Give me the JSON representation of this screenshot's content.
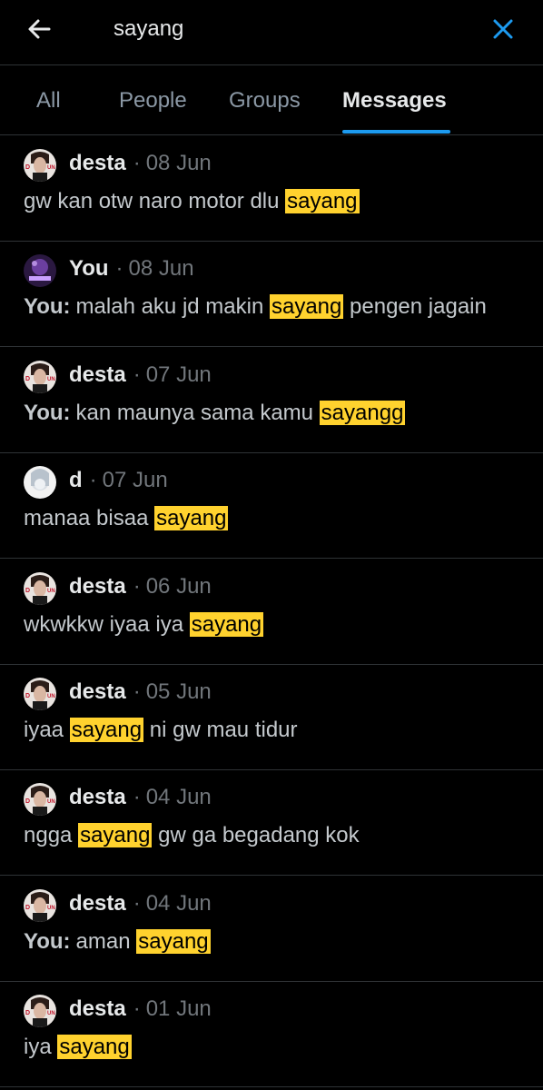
{
  "search": {
    "query": "sayang"
  },
  "tabs": [
    {
      "label": "All",
      "active": false
    },
    {
      "label": "People",
      "active": false
    },
    {
      "label": "Groups",
      "active": false
    },
    {
      "label": "Messages",
      "active": true
    }
  ],
  "colors": {
    "accent": "#1d9bf0",
    "highlight": "#ffd22e"
  },
  "messages": [
    {
      "name": "desta",
      "date": "08 Jun",
      "prefix": "",
      "before": "gw kan otw naro motor dlu ",
      "match": "sayang",
      "after": ""
    },
    {
      "name": "You",
      "date": "08 Jun",
      "prefix": "You:",
      "before": "malah aku jd makin ",
      "match": "sayang",
      "after": " pengen jagain"
    },
    {
      "name": "desta",
      "date": "07 Jun",
      "prefix": "You:",
      "before": "kan maunya sama kamu ",
      "match": "sayangg",
      "after": ""
    },
    {
      "name": "d",
      "date": "07 Jun",
      "prefix": "",
      "before": "manaa bisaa ",
      "match": "sayang",
      "after": ""
    },
    {
      "name": "desta",
      "date": "06 Jun",
      "prefix": "",
      "before": "wkwkkw iyaa iya ",
      "match": "sayang",
      "after": ""
    },
    {
      "name": "desta",
      "date": "05 Jun",
      "prefix": "",
      "before": "iyaa ",
      "match": "sayang",
      "after": " ni gw mau tidur"
    },
    {
      "name": "desta",
      "date": "04 Jun",
      "prefix": "",
      "before": "ngga ",
      "match": "sayang",
      "after": " gw ga begadang kok"
    },
    {
      "name": "desta",
      "date": "04 Jun",
      "prefix": "You:",
      "before": "aman ",
      "match": "sayang",
      "after": ""
    },
    {
      "name": "desta",
      "date": "01 Jun",
      "prefix": "",
      "before": "iya ",
      "match": "sayang",
      "after": ""
    }
  ],
  "separator": "·"
}
